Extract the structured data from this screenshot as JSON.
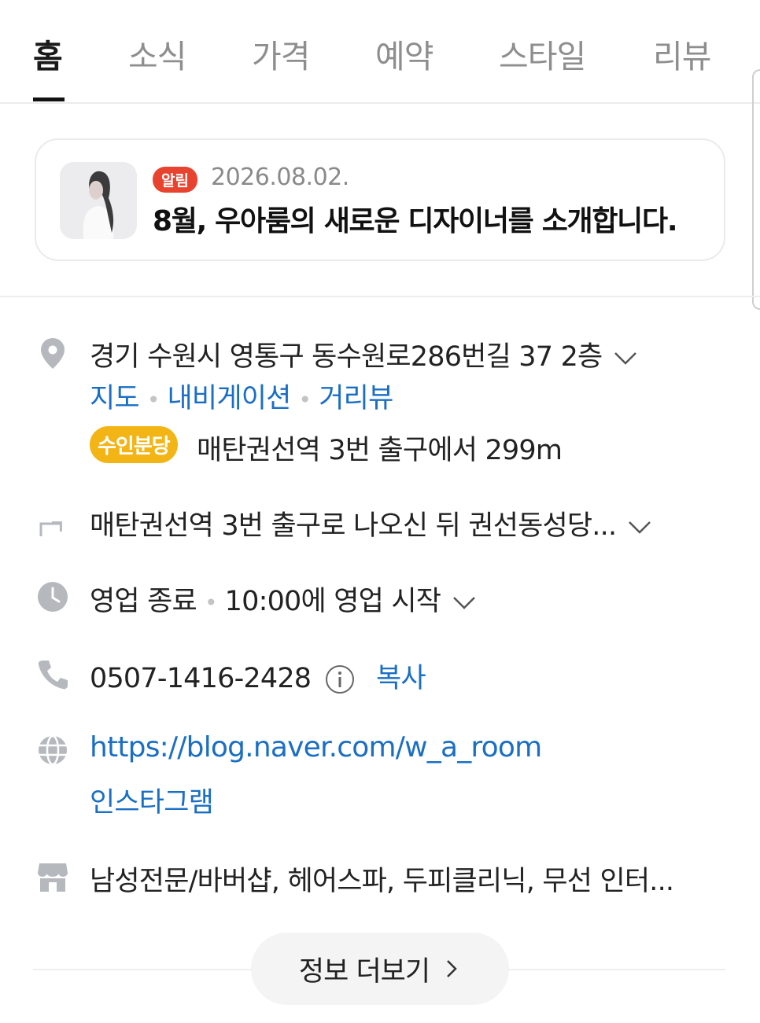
{
  "tabs": [
    "홈",
    "소식",
    "가격",
    "예약",
    "스타일",
    "리뷰"
  ],
  "notice": {
    "badge": "알림",
    "date": "2026.08.02.",
    "title": "8월, 우아룸의 새로운 디자이너를 소개합니다."
  },
  "address": {
    "text": "경기 수원시 영통구 동수원로286번길 37 2층",
    "links": [
      "지도",
      "내비게이션",
      "거리뷰"
    ]
  },
  "subway": {
    "badge": "수인분당",
    "text": "매탄권선역 3번 출구에서 299m"
  },
  "directions": {
    "text": "매탄권선역 3번 출구로 나오신 뒤 권선동성당..."
  },
  "hours": {
    "status": "영업 종료",
    "next": "10:00에 영업 시작"
  },
  "phone": {
    "number": "0507-1416-2428",
    "copy": "복사"
  },
  "websites": [
    "https://blog.naver.com/w_a_room",
    "인스타그램"
  ],
  "amenities": {
    "text": "남성전문/바버샵, 헤어스파, 두피클리닉, 무선 인터..."
  },
  "more_button": {
    "label": "정보 더보기"
  },
  "colors": {
    "link": "#1a6fc4",
    "alarm_badge": "#e8432f",
    "subway_badge": "#f3b415",
    "icon_gray": "#b5b8bd"
  }
}
